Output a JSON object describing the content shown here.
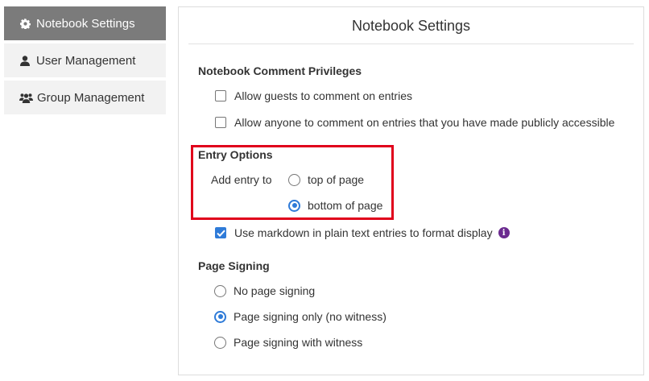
{
  "sidebar": {
    "items": [
      {
        "label": "Notebook Settings",
        "icon": "gear-icon",
        "active": true
      },
      {
        "label": "User Management",
        "icon": "user-icon",
        "active": false
      },
      {
        "label": "Group Management",
        "icon": "group-icon",
        "active": false
      }
    ]
  },
  "panel": {
    "title": "Notebook Settings",
    "comment_privileges": {
      "heading": "Notebook Comment Privileges",
      "options": [
        {
          "label": "Allow guests to comment on entries",
          "checked": false
        },
        {
          "label": "Allow anyone to comment on entries that you have made publicly accessible",
          "checked": false
        }
      ]
    },
    "entry_options": {
      "heading": "Entry Options",
      "add_entry_label": "Add entry to",
      "positions": [
        {
          "label": "top of page",
          "selected": false
        },
        {
          "label": "bottom of page",
          "selected": true
        }
      ],
      "markdown": {
        "label": "Use markdown in plain text entries to format display",
        "checked": true,
        "info_icon": "i"
      }
    },
    "page_signing": {
      "heading": "Page Signing",
      "options": [
        {
          "label": "No page signing",
          "selected": false
        },
        {
          "label": "Page signing only (no witness)",
          "selected": true
        },
        {
          "label": "Page signing with witness",
          "selected": false
        }
      ]
    }
  },
  "colors": {
    "accent": "#2f7bd8",
    "highlight": "#e0001b",
    "active_tab": "#7b7b7b",
    "info": "#6b2a8f"
  }
}
